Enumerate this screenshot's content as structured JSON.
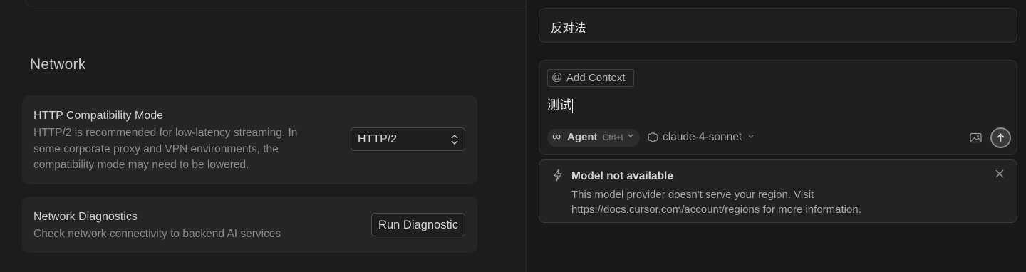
{
  "settings": {
    "section_title": "Network",
    "http_mode": {
      "title": "HTTP Compatibility Mode",
      "description_lines": [
        "HTTP/2 is recommended for low-latency streaming. In",
        "some corporate proxy and VPN environments, the",
        "compatibility mode may need to be lowered."
      ],
      "selected_value": "HTTP/2"
    },
    "diagnostics": {
      "title": "Network Diagnostics",
      "description": "Check network connectivity to backend AI services",
      "button_label": "Run Diagnostic"
    }
  },
  "chat": {
    "previous_message": "反对法",
    "composer": {
      "add_context_label": "Add Context",
      "input_text": "测试",
      "mode_label": "Agent",
      "mode_shortcut": "Ctrl+I",
      "model_label": "claude-4-sonnet"
    },
    "toast": {
      "title": "Model not available",
      "message_lines": [
        "This model provider doesn't serve your region. Visit",
        "https://docs.cursor.com/account/regions for more information."
      ]
    }
  },
  "icons": {
    "select": "chevron-up-down-icon",
    "add_context": "at-sign-icon",
    "agent": "infinity-icon",
    "model": "brain-icon",
    "image": "image-icon",
    "send": "arrow-up-icon",
    "toast": "lightning-bolt-icon",
    "close": "close-icon"
  }
}
